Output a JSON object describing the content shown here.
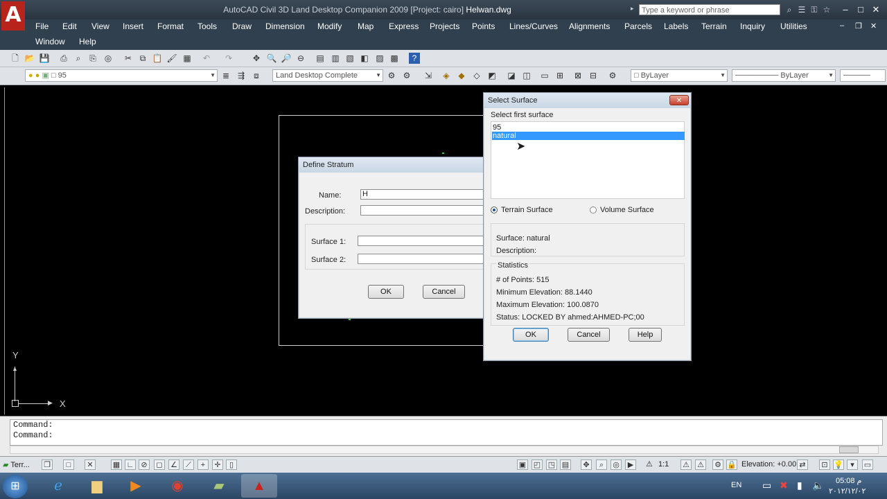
{
  "window": {
    "app_title": "AutoCAD Civil 3D Land Desktop Companion 2009 [Project: cairo]",
    "file_title": "Helwan.dwg",
    "logo_letter": "A",
    "search_placeholder": "Type a keyword or phrase"
  },
  "menu": {
    "row1": [
      "File",
      "Edit",
      "View",
      "Insert",
      "Format",
      "Tools",
      "Draw",
      "Dimension",
      "Modify",
      "Map",
      "Express",
      "Projects",
      "Points",
      "Lines/Curves",
      "Alignments",
      "Parcels",
      "Labels",
      "Terrain",
      "Inquiry",
      "Utilities"
    ],
    "row2": [
      "Window",
      "Help"
    ]
  },
  "toolbar2": {
    "layer_value": "95",
    "workspace_value": "Land Desktop Complete",
    "color_value": "ByLayer",
    "linetype_value": "ByLayer"
  },
  "define_stratum": {
    "title": "Define Stratum",
    "name_label": "Name:",
    "name_value": "H",
    "description_label": "Description:",
    "surface1_label": "Surface 1:",
    "surface2_label": "Surface 2:",
    "ok": "OK",
    "cancel": "Cancel"
  },
  "select_surface": {
    "title": "Select Surface",
    "prompt": "Select first surface",
    "items": [
      "95",
      "natural"
    ],
    "selected": "natural",
    "radio_terrain": "Terrain Surface",
    "radio_volume": "Volume Surface",
    "surface_line": "Surface: natural",
    "description_line": "Description:",
    "statistics_title": "Statistics",
    "stat_points": "# of Points: 515",
    "stat_min": "Minimum Elevation: 88.1440",
    "stat_max": "Maximum Elevation: 100.0870",
    "stat_status": "Status: LOCKED BY ahmed:AHMED-PC;00",
    "ok": "OK",
    "cancel": "Cancel",
    "help": "Help"
  },
  "ucs": {
    "y": "Y",
    "x": "X"
  },
  "command": {
    "line1": "Command:",
    "line2": "Command:"
  },
  "statusbar": {
    "tab_label": "Terr...",
    "scale": "1:1",
    "elevation": "Elevation: +0.00"
  },
  "taskbar": {
    "lang": "EN",
    "time": "05:08 م",
    "date": "٢٠١٢/١٢/٠٢"
  }
}
